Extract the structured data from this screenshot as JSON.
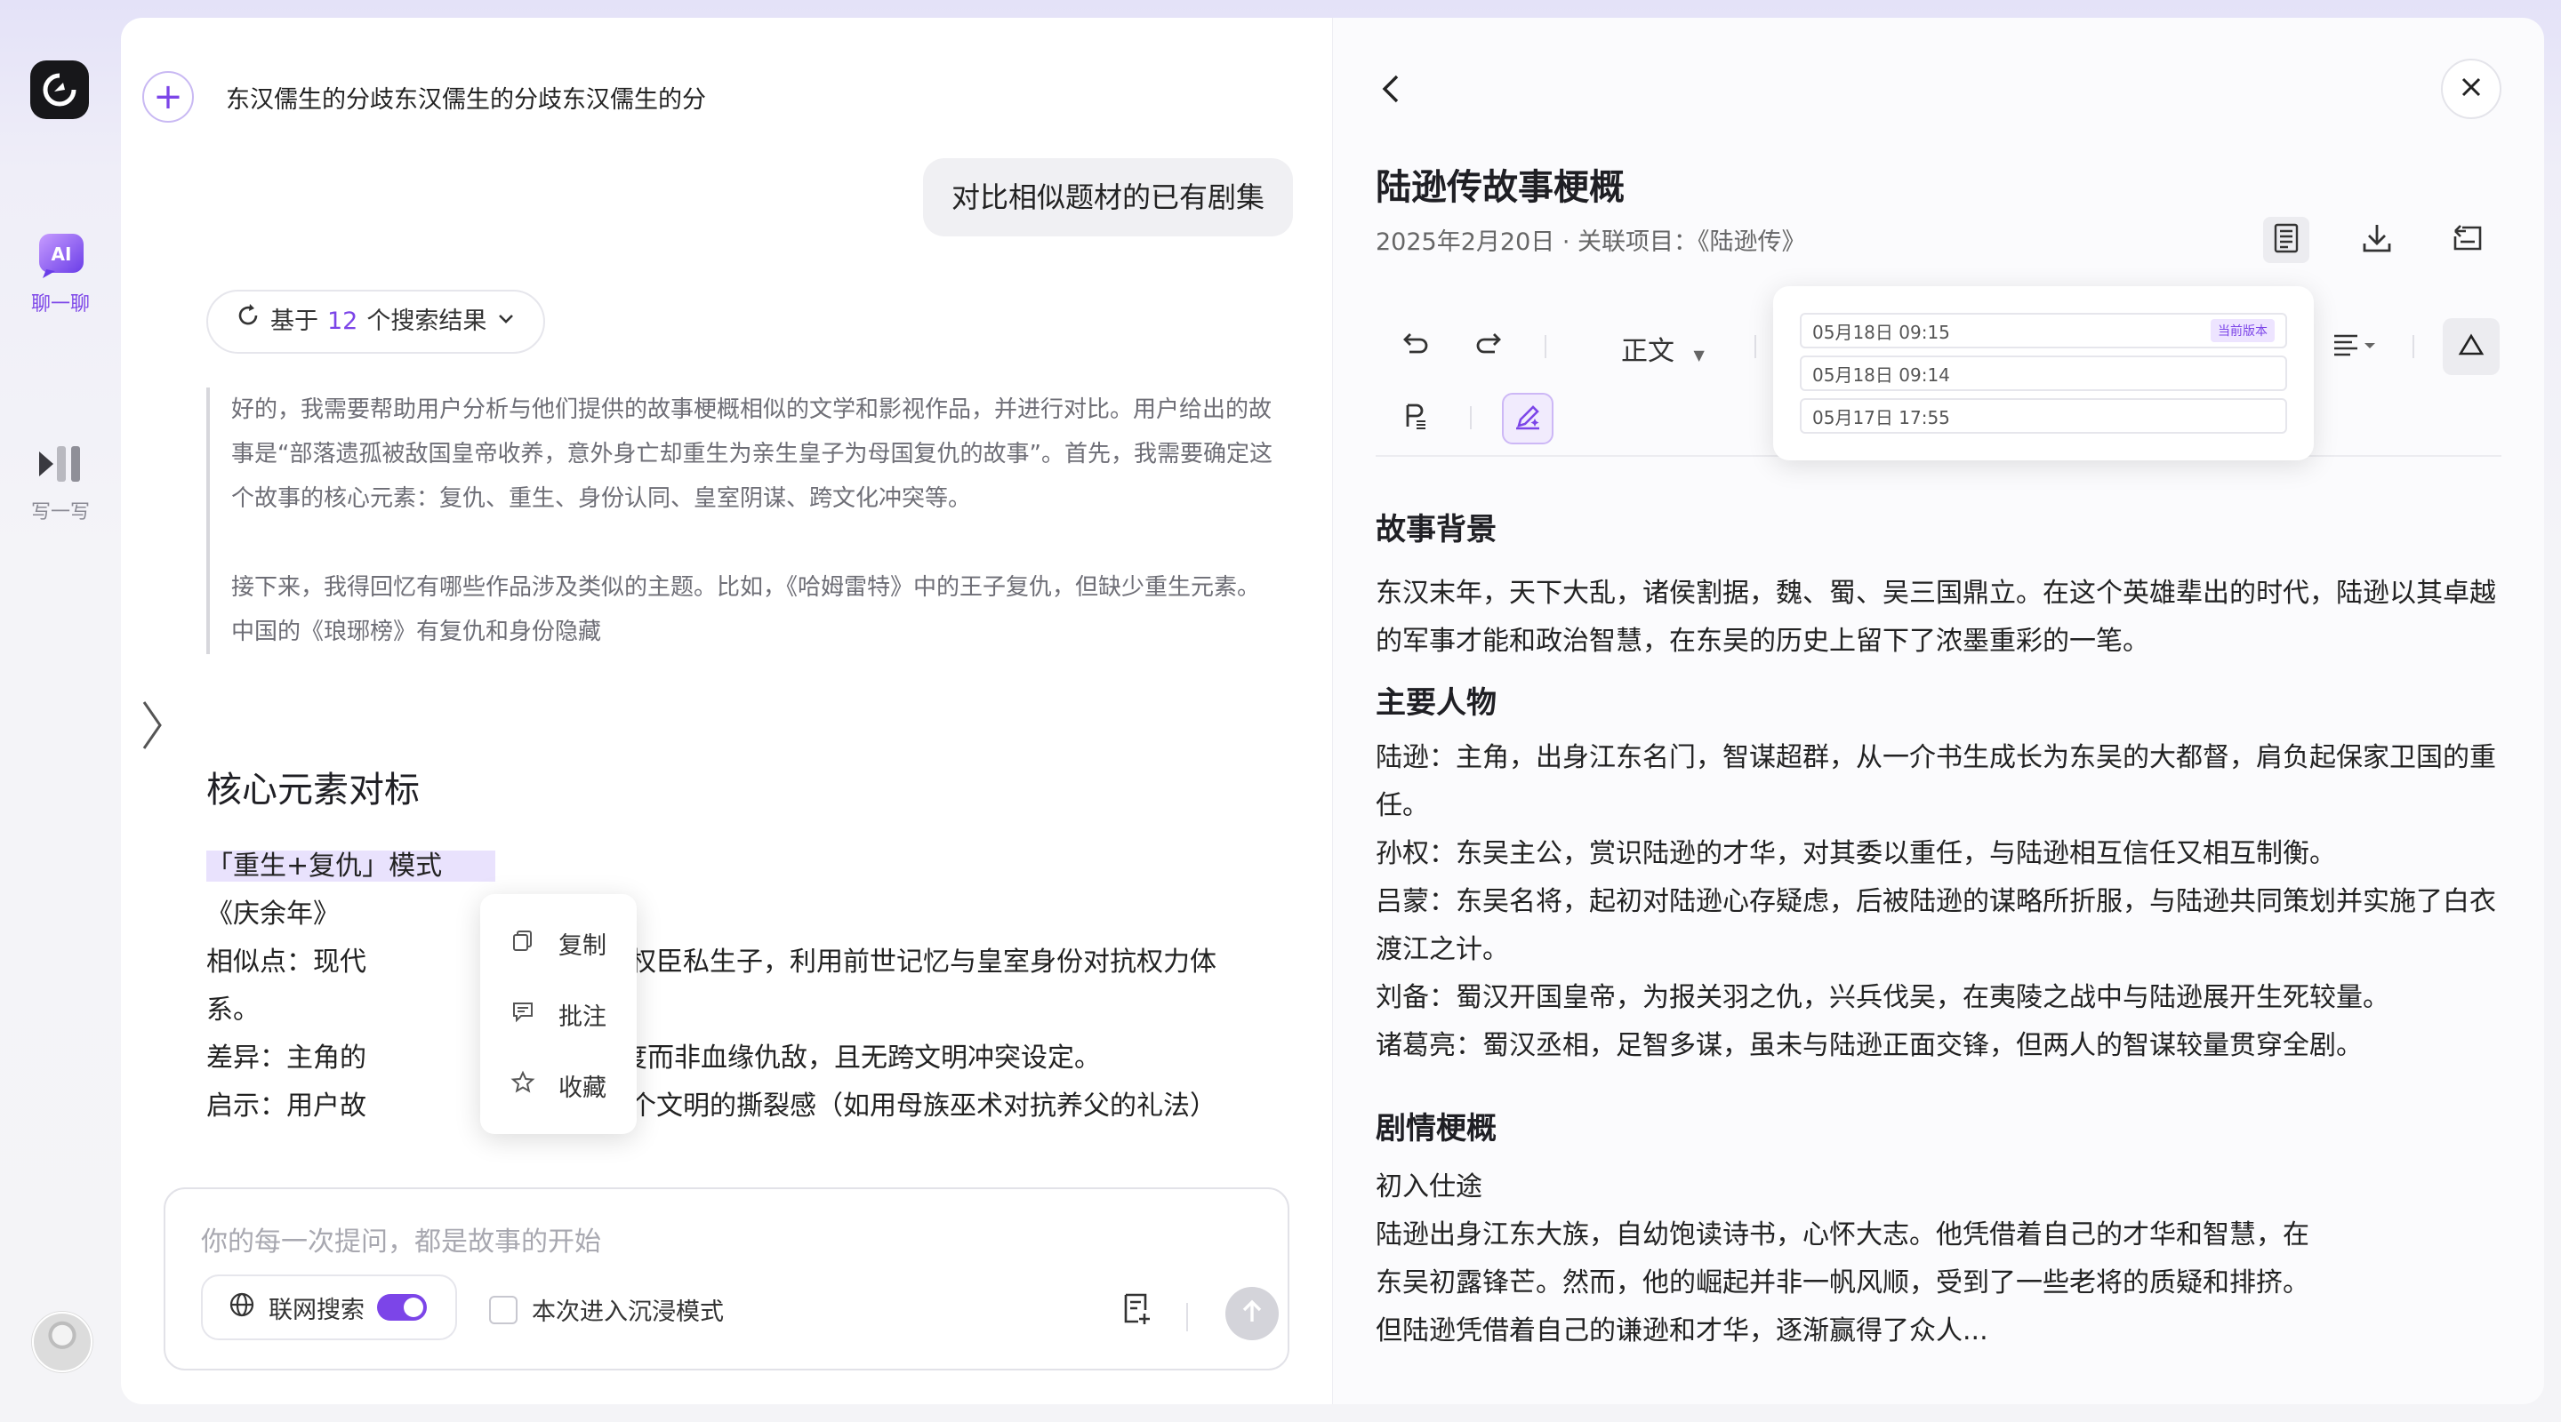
{
  "rail": {
    "items": [
      {
        "label": "聊一聊",
        "active": true
      },
      {
        "label": "写一写",
        "active": false
      }
    ]
  },
  "chat": {
    "title": "东汉儒生的分歧东汉儒生的分歧东汉儒生的分",
    "user_message": "对比相似题材的已有剧集",
    "search": {
      "prefix": "基于",
      "count": "12",
      "suffix": "个搜索结果"
    },
    "thinking": [
      "好的，我需要帮助用户分析与他们提供的故事梗概相似的文学和影视作品，并进行对比。用户给出的故事是“部落遗孤被敌国皇帝收养，意外身亡却重生为亲生皇子为母国复仇的故事”。首先，我需要确定这个故事的核心元素：复仇、重生、身份认同、皇室阴谋、跨文化冲突等。",
      "接下来，我得回忆有哪些作品涉及类似的主题。比如，《哈姆雷特》中的王子复仇，但缺少重生元素。中国的《琅琊榜》有复仇和身份隐藏"
    ],
    "section_heading": "核心元素对标",
    "lines": [
      "「重生+复仇」模式",
      "《庆余年》",
      ")",
      "相似点：现代",
      "主为庆国权臣私生子，利用前世记忆与皇室身份对抗权力体",
      "系。",
      "差异：主角的",
      "更偏向制度而非血缘仇敌，且无跨文明冲突设定。",
      "启示：用户故",
      "主角对两个文明的撕裂感（如用母族巫术对抗养父的礼法）"
    ],
    "context_menu": [
      "复制",
      "批注",
      "收藏"
    ],
    "composer": {
      "placeholder": "你的每一次提问，都是故事的开始",
      "web_search_label": "联网搜索",
      "web_search_on": true,
      "immersive_label": "本次进入沉浸模式"
    }
  },
  "doc": {
    "title": "陆逊传故事梗概",
    "meta": "2025年2月20日 · 关联项目：《陆逊传》",
    "style_select": "正文",
    "versions": [
      {
        "time": "05月18日 09:15",
        "badge": "当前版本"
      },
      {
        "time": "05月18日 09:14",
        "badge": ""
      },
      {
        "time": "05月17日 17:55",
        "badge": ""
      }
    ],
    "sections": [
      {
        "heading": "故事背景",
        "paras": [
          "东汉末年，天下大乱，诸侯割据，魏、蜀、吴三国鼎立。在这个英雄辈出的时代，陆逊以其卓越的军事才能和政治智慧，在东吴的历史上留下了浓墨重彩的一笔。"
        ]
      },
      {
        "heading": "主要人物",
        "paras": [
          "陆逊：主角，出身江东名门，智谋超群，从一介书生成长为东吴的大都督，肩负起保家卫国的重任。",
          "孙权：东吴主公，赏识陆逊的才华，对其委以重任，与陆逊相互信任又相互制衡。",
          "吕蒙：东吴名将，起初对陆逊心存疑虑，后被陆逊的谋略所折服，与陆逊共同策划并实施了白衣渡江之计。",
          "刘备：蜀汉开国皇帝，为报关羽之仇，兴兵伐吴，在夷陵之战中与陆逊展开生死较量。",
          "诸葛亮：蜀汉丞相，足智多谋，虽未与陆逊正面交锋，但两人的智谋较量贯穿全剧。"
        ]
      },
      {
        "heading": "剧情梗概",
        "paras": [
          "初入仕途",
          "陆逊出身江东大族，自幼饱读诗书，心怀大志。他凭借着自己的才华和智慧，在",
          "东吴初露锋芒。然而，他的崛起并非一帆风顺，受到了一些老将的质疑和排挤。",
          "但陆逊凭借着自己的谦逊和才华，逐渐赢得了众人..."
        ]
      }
    ]
  },
  "colors": {
    "accent": "#7c45e8",
    "rail_bg": "#f4f4f8",
    "logo_bg": "#17171a"
  },
  "icons": [
    "app-logo-icon",
    "chat-ai-icon",
    "write-icon",
    "plus-icon",
    "refresh-icon",
    "chevron-down-icon",
    "collapse-arrow-icon",
    "copy-icon",
    "comment-icon",
    "star-icon",
    "globe-icon",
    "doc-add-icon",
    "send-arrow-icon",
    "back-icon",
    "close-icon",
    "outline-icon",
    "download-icon",
    "export-icon",
    "undo-icon",
    "redo-icon",
    "format-painter-icon",
    "ai-pen-icon",
    "align-icon",
    "triangle-icon"
  ]
}
